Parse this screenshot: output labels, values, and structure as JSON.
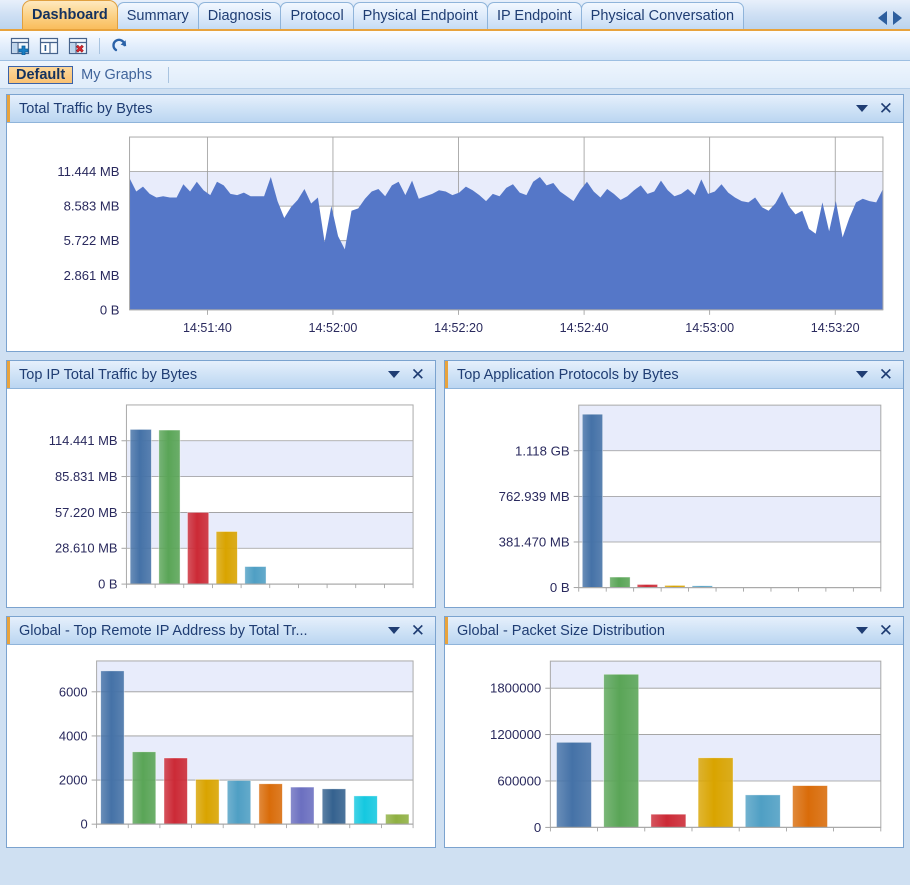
{
  "tabs": [
    {
      "label": "Dashboard",
      "active": true
    },
    {
      "label": "Summary",
      "active": false
    },
    {
      "label": "Diagnosis",
      "active": false
    },
    {
      "label": "Protocol",
      "active": false
    },
    {
      "label": "Physical Endpoint",
      "active": false
    },
    {
      "label": "IP Endpoint",
      "active": false
    },
    {
      "label": "Physical Conversation",
      "active": false
    }
  ],
  "tab_scroll": {
    "left_icon": "scroll-left-icon",
    "right_icon": "scroll-right-icon"
  },
  "toolbar": {
    "buttons": [
      {
        "name": "add-panel-icon",
        "title": "Add Panel"
      },
      {
        "name": "panel-properties-icon",
        "title": "Panel Properties"
      },
      {
        "name": "delete-panel-icon",
        "title": "Delete Panel"
      },
      {
        "name": "refresh-icon",
        "title": "Refresh"
      }
    ]
  },
  "subtabs": [
    {
      "label": "Default",
      "active": true
    },
    {
      "label": "My Graphs",
      "active": false
    }
  ],
  "panels": [
    {
      "title": "Total Traffic by Bytes",
      "caret": "chevron-down-icon",
      "close": "close-icon"
    },
    {
      "title": "Top IP Total Traffic by Bytes",
      "caret": "chevron-down-icon",
      "close": "close-icon"
    },
    {
      "title": "Top Application Protocols by Bytes",
      "caret": "chevron-down-icon",
      "close": "close-icon"
    },
    {
      "title": "Global - Top Remote IP Address by Total Tr...",
      "caret": "chevron-down-icon",
      "close": "close-icon"
    },
    {
      "title": "Global - Packet Size Distribution",
      "caret": "chevron-down-icon",
      "close": "close-icon"
    }
  ],
  "palette": {
    "blue": "#4572a7",
    "green": "#5aa557",
    "red": "#cc2a36",
    "gold": "#d9a400",
    "lightblue": "#4f9fc4",
    "orange": "#d96c0a",
    "purple": "#6b6fc0",
    "navy": "#35628f",
    "cyan": "#15c8e0",
    "olive": "#8fb042",
    "area_fill": "#5577c8",
    "band": "#e8ecfb",
    "grid": "#9a9a9a"
  },
  "chart_data": [
    {
      "type": "area",
      "title": "Total Traffic by Bytes",
      "xlabel": "",
      "ylabel": "",
      "ylim": [
        0,
        14.305
      ],
      "yticks": [
        0,
        2.861,
        5.722,
        8.583,
        11.444
      ],
      "ytick_labels": [
        "0 B",
        "2.861 MB",
        "5.722 MB",
        "8.583 MB",
        "11.444 MB"
      ],
      "xtick_labels": [
        "14:51:40",
        "14:52:00",
        "14:52:20",
        "14:52:40",
        "14:53:00",
        "14:53:20"
      ],
      "grid": true,
      "unit": "MB",
      "values": [
        10.9,
        9.8,
        10.2,
        9.6,
        9.3,
        9.4,
        9.3,
        9.3,
        10.4,
        9.8,
        10.6,
        9.9,
        9.5,
        10.6,
        10.3,
        9.6,
        9.5,
        9.7,
        9.4,
        9.4,
        9.4,
        11.0,
        9.0,
        7.6,
        8.5,
        9.1,
        10.0,
        8.8,
        9.3,
        5.6,
        8.6,
        6.1,
        5.0,
        8.2,
        8.4,
        9.2,
        9.8,
        10.0,
        9.4,
        10.3,
        10.6,
        9.5,
        10.7,
        9.2,
        9.4,
        9.6,
        9.9,
        9.8,
        9.5,
        9.7,
        10.2,
        9.9,
        9.5,
        9.0,
        9.6,
        9.4,
        10.1,
        10.4,
        9.7,
        9.5,
        10.6,
        11.0,
        10.3,
        10.5,
        9.8,
        9.4,
        9.0,
        9.9,
        10.6,
        9.8,
        9.3,
        10.0,
        9.6,
        9.1,
        9.4,
        9.9,
        10.3,
        9.6,
        9.8,
        10.7,
        9.9,
        9.4,
        9.6,
        10.0,
        9.5,
        10.8,
        9.6,
        9.8,
        10.4,
        9.7,
        9.3,
        9.0,
        8.9,
        9.3,
        8.5,
        8.2,
        8.8,
        9.8,
        8.6,
        7.9,
        8.2,
        6.7,
        6.3,
        8.9,
        6.5,
        9.0,
        6.0,
        7.6,
        8.9,
        9.2,
        9.0,
        8.9,
        10.0
      ]
    },
    {
      "type": "bar",
      "title": "Top IP Total Traffic by Bytes",
      "xlabel": "",
      "ylabel": "",
      "ylim": [
        0,
        143.051
      ],
      "yticks": [
        0,
        28.61,
        57.22,
        85.831,
        114.441
      ],
      "ytick_labels": [
        "0 B",
        "28.610 MB",
        "57.220 MB",
        "85.831 MB",
        "114.441 MB"
      ],
      "unit": "MB",
      "grid": true,
      "slots": 10,
      "values": [
        123.5,
        123.0,
        57.2,
        42.0,
        14.0
      ],
      "colors": [
        "#4572a7",
        "#5aa557",
        "#cc2a36",
        "#d9a400",
        "#4f9fc4"
      ]
    },
    {
      "type": "bar",
      "title": "Top Application Protocols by Bytes",
      "xlabel": "",
      "ylabel": "",
      "ylim": [
        0,
        1526
      ],
      "yticks": [
        0,
        381.47,
        762.939,
        1144.409
      ],
      "ytick_labels": [
        "0 B",
        "381.470 MB",
        "762.939 MB",
        "1.118 GB"
      ],
      "unit": "MB",
      "grid": true,
      "slots": 11,
      "values": [
        1450,
        88,
        26,
        18,
        15
      ],
      "colors": [
        "#4572a7",
        "#5aa557",
        "#cc2a36",
        "#d9a400",
        "#4f9fc4"
      ]
    },
    {
      "type": "bar",
      "title": "Global - Top Remote IP Address by Total Tr...",
      "xlabel": "",
      "ylabel": "",
      "ylim": [
        0,
        7400
      ],
      "yticks": [
        0,
        2000,
        4000,
        6000
      ],
      "ytick_labels": [
        "0",
        "2000",
        "4000",
        "6000"
      ],
      "grid": true,
      "slots": 10,
      "values": [
        6950,
        3280,
        3000,
        2030,
        1980,
        1830,
        1680,
        1600,
        1280,
        450
      ],
      "colors": [
        "#4572a7",
        "#5aa557",
        "#cc2a36",
        "#d9a400",
        "#4f9fc4",
        "#d96c0a",
        "#6b6fc0",
        "#35628f",
        "#15c8e0",
        "#8fb042"
      ]
    },
    {
      "type": "bar",
      "title": "Global - Packet Size Distribution",
      "xlabel": "",
      "ylabel": "",
      "ylim": [
        0,
        2150000
      ],
      "yticks": [
        0,
        600000,
        1200000,
        1800000
      ],
      "ytick_labels": [
        "0",
        "600000",
        "1200000",
        "1800000"
      ],
      "grid": true,
      "slots": 7,
      "values": [
        1100000,
        1980000,
        170000,
        900000,
        420000,
        540000
      ],
      "colors": [
        "#4572a7",
        "#5aa557",
        "#cc2a36",
        "#d9a400",
        "#4f9fc4",
        "#d96c0a"
      ]
    }
  ]
}
